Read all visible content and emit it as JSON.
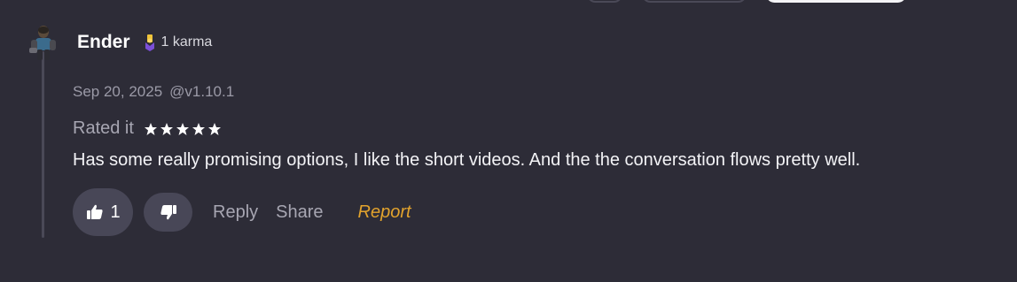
{
  "top_controls": [
    "partial-pill",
    "partial-pill",
    "partial-pill-active"
  ],
  "user": {
    "name": "Ender",
    "karma_label": "1 karma",
    "avatar_icon": "person-avatar"
  },
  "meta": {
    "date": "Sep 20, 2025",
    "version": "@v1.10.1"
  },
  "rating": {
    "label": "Rated it",
    "stars": 5,
    "max_stars": 5
  },
  "comment": {
    "text": "Has some really promising options, I like the short videos. And the the conversation flows pretty well."
  },
  "actions": {
    "upvote_count": "1",
    "reply_label": "Reply",
    "share_label": "Share",
    "report_label": "Report"
  },
  "colors": {
    "background": "#2d2c37",
    "pill": "#484757",
    "report": "#e2a32d",
    "karma_icon": "#f0c43a",
    "muted_text": "#9b9aa7"
  }
}
